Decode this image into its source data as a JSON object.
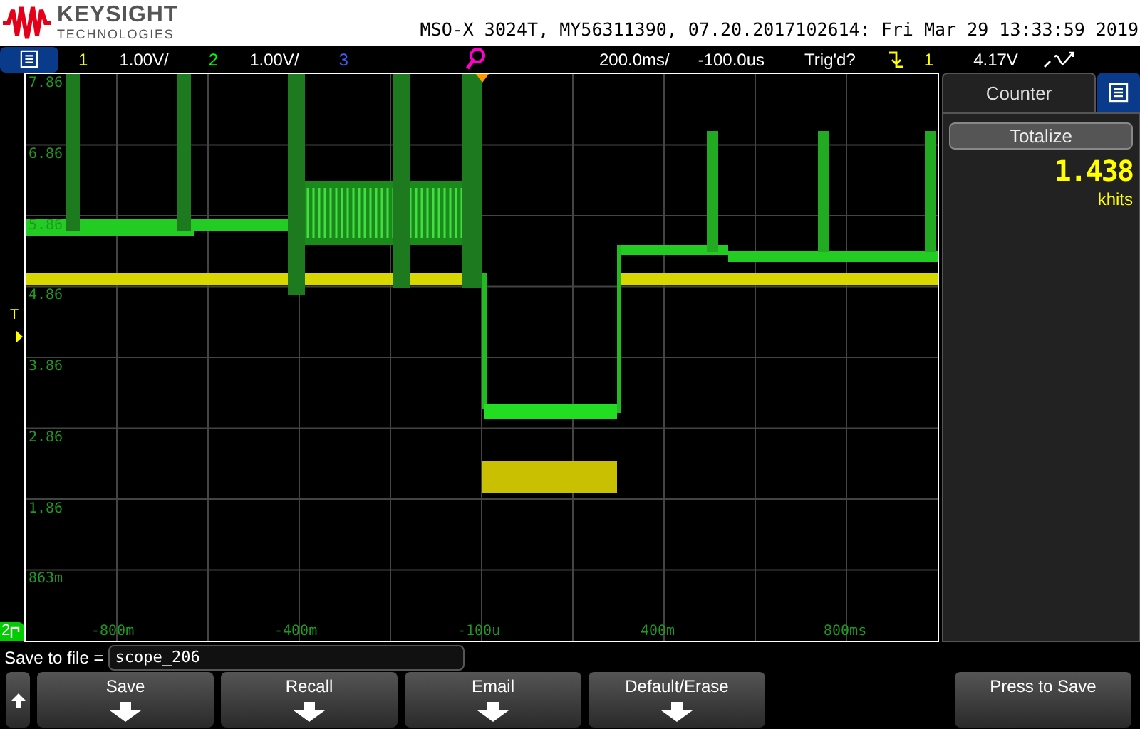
{
  "header": {
    "brand": "KEYSIGHT",
    "brand_sub": "TECHNOLOGIES",
    "instrument": "MSO-X 3024T, MY56311390, 07.20.2017102614: Fri Mar 29 13:33:59 2019"
  },
  "toolbar": {
    "channels": [
      {
        "number": "1",
        "scale": "1.00V/",
        "color": "#ffff00"
      },
      {
        "number": "2",
        "scale": "1.00V/",
        "color": "#00ff00"
      },
      {
        "number": "3",
        "color": "#4060ff"
      }
    ],
    "timebase": "200.0ms/",
    "delay": "-100.0us",
    "trigger_status": "Trig'd?",
    "trigger_source": "1",
    "trigger_level": "4.17V"
  },
  "plot": {
    "y_labels": [
      "7.86",
      "6.86",
      "5.86",
      "4.86",
      "3.86",
      "2.86",
      "1.86",
      "863m"
    ],
    "x_labels": [
      "-800m",
      "-400m",
      "-100u",
      "400m",
      "800ms"
    ],
    "trigger_marker": "T",
    "channel_badge": "2"
  },
  "panel": {
    "tab": "Counter",
    "mode": "Totalize",
    "value": "1.438",
    "unit": "khits"
  },
  "save": {
    "label": "Save to file =",
    "value": "scope_206"
  },
  "softkeys": [
    {
      "label": "Save",
      "kind": "menu"
    },
    {
      "label": "Recall",
      "kind": "menu"
    },
    {
      "label": "Email",
      "kind": "menu"
    },
    {
      "label": "Default/Erase",
      "kind": "menu"
    },
    {
      "label": "Press to Save",
      "kind": "action"
    }
  ]
}
